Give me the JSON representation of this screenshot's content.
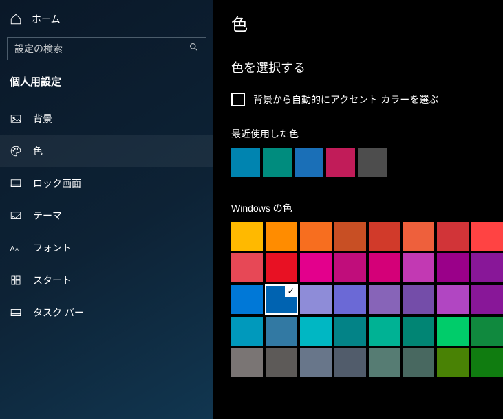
{
  "sidebar": {
    "home": "ホーム",
    "searchPlaceholder": "設定の検索",
    "category": "個人用設定",
    "items": [
      {
        "label": "背景",
        "icon": "picture"
      },
      {
        "label": "色",
        "icon": "palette"
      },
      {
        "label": "ロック画面",
        "icon": "lock-screen"
      },
      {
        "label": "テーマ",
        "icon": "theme"
      },
      {
        "label": "フォント",
        "icon": "font"
      },
      {
        "label": "スタート",
        "icon": "start"
      },
      {
        "label": "タスク バー",
        "icon": "taskbar"
      }
    ],
    "activeIndex": 1
  },
  "main": {
    "title": "色",
    "sectionTitle": "色を選択する",
    "autoAccentLabel": "背景から自動的にアクセント カラーを選ぶ",
    "recentLabel": "最近使用した色",
    "recentColors": [
      "#0084b0",
      "#008c7e",
      "#1a6fb7",
      "#c11c59",
      "#4d4d4d"
    ],
    "windowsLabel": "Windows の色",
    "windowsColors": [
      [
        "#ffb900",
        "#ff8c00",
        "#f76e1f",
        "#c84f24",
        "#d13a2a",
        "#ee603c",
        "#d13438",
        "#ff4343"
      ],
      [
        "#e74856",
        "#e81123",
        "#e3008c",
        "#c00d7b",
        "#d40078",
        "#c239b3",
        "#9a0089",
        "#881798"
      ],
      [
        "#0078d7",
        "#0063b1",
        "#8e8cd8",
        "#6b69d6",
        "#8764b8",
        "#744da9",
        "#b146c2",
        "#881798"
      ],
      [
        "#0099bc",
        "#3279a3",
        "#00b7c3",
        "#038387",
        "#00b294",
        "#018574",
        "#00cc6a",
        "#10893e"
      ],
      [
        "#7a7574",
        "#5d5a58",
        "#68768a",
        "#515c6b",
        "#567c73",
        "#486860",
        "#498205",
        "#107c10"
      ]
    ],
    "selectedRow": 2,
    "selectedCol": 1
  }
}
